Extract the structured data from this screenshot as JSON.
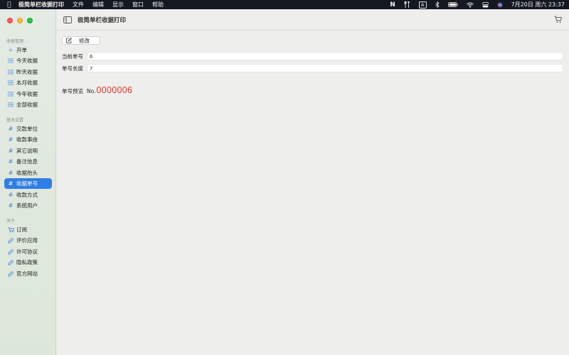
{
  "menubar": {
    "app_name": "极简单栏收据打印",
    "menus": [
      "文件",
      "编辑",
      "显示",
      "窗口",
      "帮助"
    ],
    "input_indicator": "A",
    "clock": "7月20日 周六 23:37"
  },
  "window": {
    "title": "极简单栏收据打印"
  },
  "sidebar": {
    "sections": [
      {
        "title": "收据管理",
        "items": [
          {
            "label": "开单",
            "icon": "plus-icon"
          },
          {
            "label": "今天收据",
            "icon": "list-icon"
          },
          {
            "label": "昨天收据",
            "icon": "list-icon"
          },
          {
            "label": "本月收据",
            "icon": "list-icon"
          },
          {
            "label": "今年收据",
            "icon": "list-icon"
          },
          {
            "label": "全部收据",
            "icon": "list-icon"
          }
        ]
      },
      {
        "title": "基本设置",
        "items": [
          {
            "label": "交款单位",
            "icon": "hash-icon"
          },
          {
            "label": "收款事由",
            "icon": "hash-icon"
          },
          {
            "label": "其它说明",
            "icon": "hash-icon"
          },
          {
            "label": "备注信息",
            "icon": "hash-icon"
          },
          {
            "label": "收据抬头",
            "icon": "hash-icon"
          },
          {
            "label": "收据单号",
            "icon": "hash-icon",
            "active": true
          },
          {
            "label": "收款方式",
            "icon": "hash-icon"
          },
          {
            "label": "系统用户",
            "icon": "hash-icon"
          }
        ]
      },
      {
        "title": "关于",
        "items": [
          {
            "label": "订阅",
            "icon": "cart-icon"
          },
          {
            "label": "评价应用",
            "icon": "link-icon"
          },
          {
            "label": "许可协议",
            "icon": "link-icon"
          },
          {
            "label": "隐私政策",
            "icon": "link-icon"
          },
          {
            "label": "官方网站",
            "icon": "link-icon"
          }
        ]
      }
    ]
  },
  "main": {
    "edit_button_label": "修改",
    "current_number": {
      "label": "当前单号",
      "value": "6"
    },
    "number_length": {
      "label": "单号长度",
      "value": "7"
    },
    "preview": {
      "label": "单号预览",
      "prefix": "No.",
      "number": "0000006"
    }
  },
  "colors": {
    "accent": "#2f7ee6",
    "preview_number": "#e0362a",
    "icon_blue": "#3e7fd6"
  }
}
